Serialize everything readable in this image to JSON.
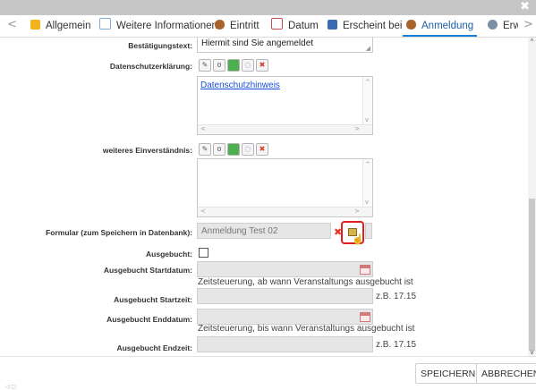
{
  "window": {
    "close_glyph": "✖"
  },
  "tabs": [
    {
      "label": "Allgemein",
      "icon": "folder-icon",
      "color": "#f2b31b"
    },
    {
      "label": "Weitere Informationen",
      "icon": "document-icon",
      "color": "#7ea9d6"
    },
    {
      "label": "Eintritt",
      "icon": "people-icon",
      "color": "#a8632a"
    },
    {
      "label": "Datum",
      "icon": "calendar-icon",
      "color": "#c44d4d"
    },
    {
      "label": "Erscheint bei",
      "icon": "chart-icon",
      "color": "#3b6bb0"
    },
    {
      "label": "Anmeldung",
      "icon": "people-icon",
      "color": "#a8632a"
    },
    {
      "label": "Erwe",
      "icon": "extension-icon",
      "color": "#7a8fa6"
    }
  ],
  "tabnav": {
    "prev": "<",
    "next": ">"
  },
  "form": {
    "bestaetigung": {
      "label": "Bestätigungstext:",
      "value": "Hiermit sind Sie angemeldet"
    },
    "datenschutz": {
      "label": "Datenschutzerklärung:",
      "link": "Datenschutzhinweis"
    },
    "einverstaendnis": {
      "label": "weiteres Einverständnis:"
    },
    "formular": {
      "label": "Formular (zum Speichern in Datenbank):",
      "value": "Anmeldung Test 02"
    },
    "ausgebucht": {
      "label": "Ausgebucht:",
      "checked": false
    },
    "startdatum": {
      "label": "Ausgebucht Startdatum:",
      "hint": "Zeitsteuerung, ab wann Veranstaltungs ausgebucht ist"
    },
    "startzeit": {
      "label": "Ausgebucht Startzeit:",
      "hint": "z.B. 17.15"
    },
    "enddatum": {
      "label": "Ausgebucht Enddatum:",
      "hint": "Zeitsteuerung, bis wann Veranstaltungs ausgebucht ist"
    },
    "endzeit": {
      "label": "Ausgebucht Endzeit:",
      "hint": "z.B. 17.15"
    }
  },
  "toolbar_icons": [
    "edit-icon",
    "source-icon",
    "color-icon",
    "comment-icon",
    "delete-icon"
  ],
  "footer": {
    "save": "SPEICHERN",
    "cancel": "ABBRECHEN"
  },
  "accent": "#1a7fd8",
  "highlight": "#e0201e"
}
